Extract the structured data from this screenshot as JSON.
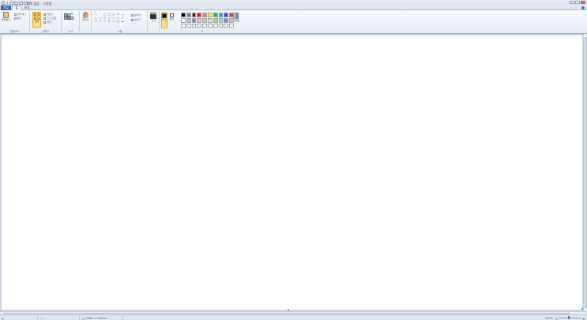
{
  "window": {
    "title": "제목 없음 - 그림판"
  },
  "tabs": {
    "file": "파일",
    "home": "홈",
    "view": "보기"
  },
  "ribbon": {
    "clipboard": {
      "label": "클립보드",
      "paste": "붙여넣기",
      "cut": "잘라내기",
      "copy": "복사"
    },
    "image": {
      "label": "이미지",
      "select": "선택",
      "crop": "자르기",
      "resize": "크기 조정",
      "rotate": "회전"
    },
    "tools": {
      "label": "도구",
      "text_tool": "A"
    },
    "brushes": "브러시",
    "shapes": {
      "label": "도형",
      "outline": "윤곽선",
      "fill": "채우기"
    },
    "size": "크기",
    "colors": {
      "label": "색",
      "color1": "색 1",
      "color2": "색 2",
      "edit": "색 편집",
      "palette": [
        "#000000",
        "#7f7f7f",
        "#880015",
        "#ed1c24",
        "#ff7f27",
        "#fff200",
        "#22b14c",
        "#00a2e8",
        "#3f48cc",
        "#a349a4",
        "#ffffff",
        "#c3c3c3",
        "#b97a57",
        "#ffaec9",
        "#ffc90e",
        "#efe4b0",
        "#b5e61d",
        "#99d9ea",
        "#7092be",
        "#c8bfe7",
        "#ffffff",
        "#ffffff",
        "#ffffff",
        "#ffffff",
        "#ffffff",
        "#ffffff",
        "#ffffff",
        "#ffffff",
        "#ffffff",
        "#ffffff"
      ],
      "color1_value": "#000000",
      "color2_value": "#ffffff"
    }
  },
  "status": {
    "canvas_size": "2560 × 1401px",
    "zoom": "100%"
  }
}
